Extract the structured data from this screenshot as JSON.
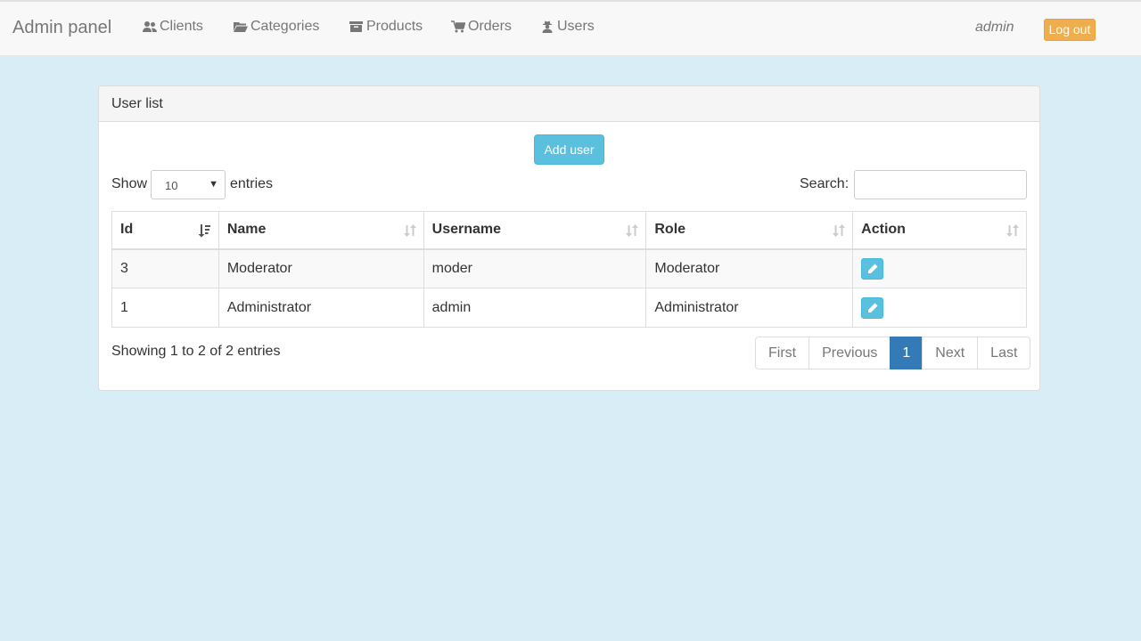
{
  "navbar": {
    "brand": "Admin panel",
    "items": [
      {
        "label": "Clients",
        "icon": "users-icon"
      },
      {
        "label": "Categories",
        "icon": "folder-open-icon"
      },
      {
        "label": "Products",
        "icon": "archive-icon"
      },
      {
        "label": "Orders",
        "icon": "shopping-cart-icon"
      },
      {
        "label": "Users",
        "icon": "user-secret-icon"
      }
    ],
    "current_user": "admin",
    "logout_label": "Log out"
  },
  "panel": {
    "title": "User list",
    "add_button_label": "Add user",
    "length": {
      "show_label": "Show",
      "selected": "10",
      "entries_label": "entries"
    },
    "search": {
      "label": "Search:",
      "value": "",
      "placeholder": ""
    },
    "table": {
      "columns": [
        "Id",
        "Name",
        "Username",
        "Role",
        "Action"
      ],
      "sorted_column": "Id",
      "sort_direction": "descending",
      "rows": [
        {
          "id": "3",
          "name": "Moderator",
          "username": "moder",
          "role": "Moderator",
          "action_icon": "pencil-icon"
        },
        {
          "id": "1",
          "name": "Administrator",
          "username": "admin",
          "role": "Administrator",
          "action_icon": "pencil-icon"
        }
      ]
    },
    "info": "Showing 1 to 2 of 2 entries",
    "pagination": [
      "First",
      "Previous",
      "1",
      "Next",
      "Last"
    ],
    "current_page": "1"
  },
  "colors": {
    "page_background": "#d9edf7",
    "navbar_background": "#f8f8f8",
    "logout_button": "#f0ad4e",
    "info_button": "#5bc0de",
    "active_page": "#337ab7"
  }
}
